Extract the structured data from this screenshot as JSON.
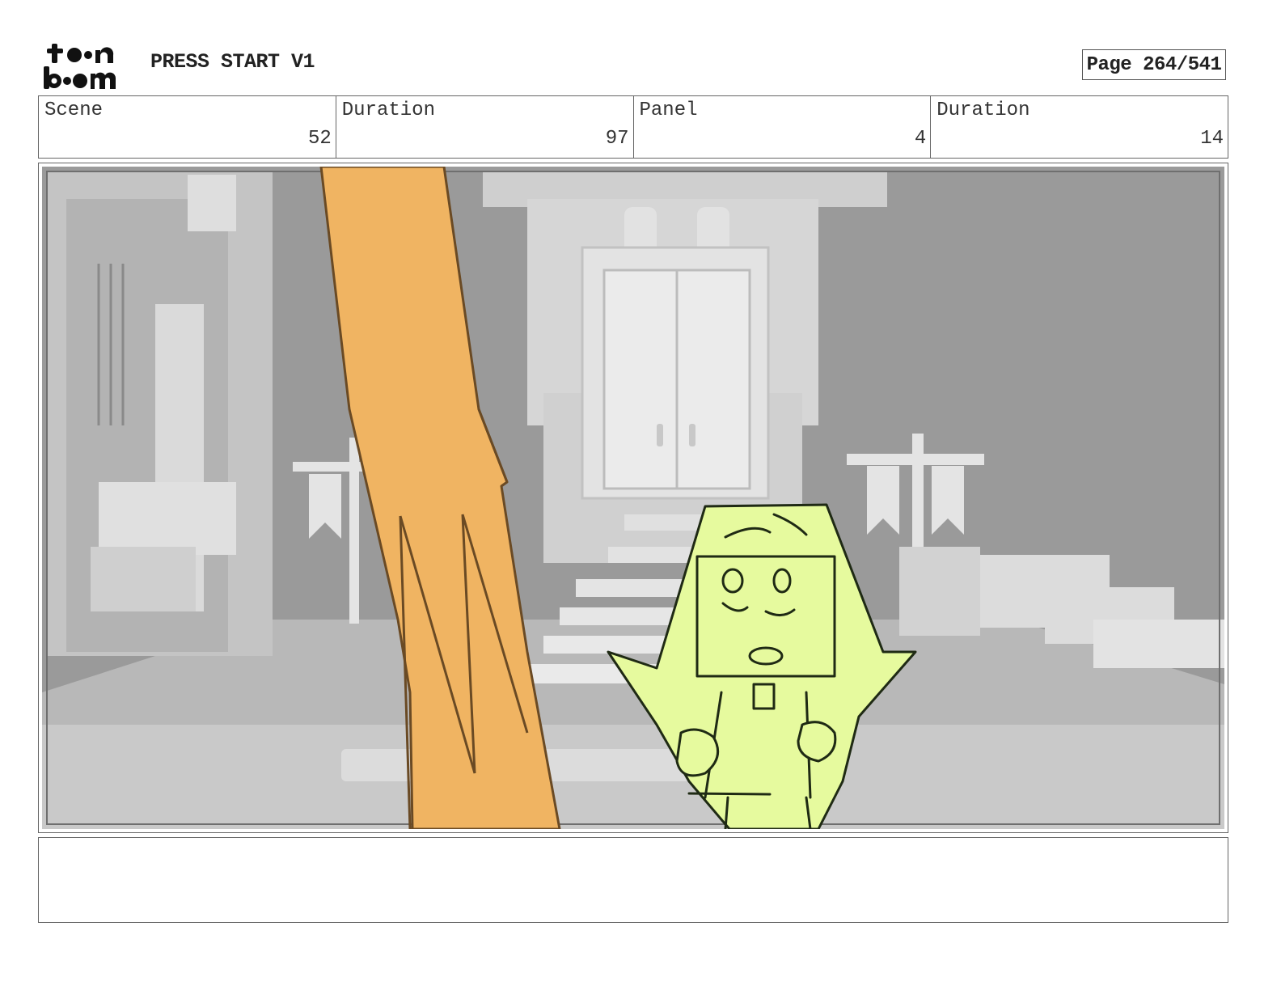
{
  "header": {
    "logo_text": "toon boom",
    "project_title": "PRESS START V1",
    "page_label": "Page 264/541"
  },
  "info": [
    {
      "label": "Scene",
      "value": "52"
    },
    {
      "label": "Duration",
      "value": "97"
    },
    {
      "label": "Panel",
      "value": "4"
    },
    {
      "label": "Duration",
      "value": "14"
    }
  ],
  "panel": {
    "description_colors": {
      "background_gray": "#9a9a9a",
      "building_light": "#d9d9d9",
      "orange_shape": "#f0b462",
      "character_yellow": "#e6fa9e"
    }
  },
  "notes": {
    "text": ""
  }
}
